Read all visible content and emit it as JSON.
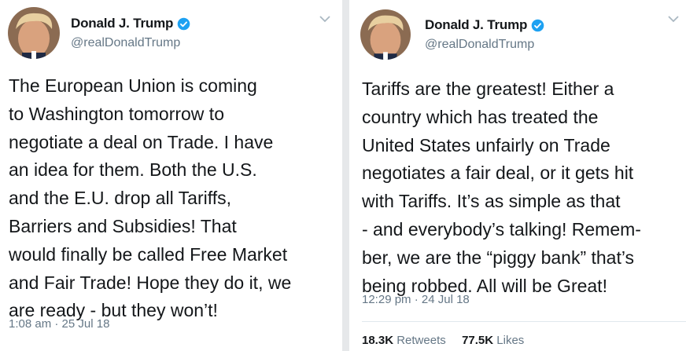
{
  "tweets": [
    {
      "author": {
        "name": "Donald J. Trump",
        "handle": "@realDonaldTrump",
        "verified": true
      },
      "text": "The European Union is coming\nto Washington tomorrow to\nnegotiate a deal on Trade. I have\nan idea for them. Both the U.S.\nand the E.U. drop all Tariffs,\nBarriers and Subsidies! That\nwould finally be called Free Market\nand Fair Trade! Hope they do it, we\nare ready - but they won’t!",
      "timestamp": "1:08 am · 25 Jul 18"
    },
    {
      "author": {
        "name": "Donald J. Trump",
        "handle": "@realDonaldTrump",
        "verified": true
      },
      "text": "Tariffs are the greatest! Either a\ncountry which has treated the\nUnited States unfairly on Trade\nnegotiates a fair deal, or it gets hit\nwith Tariffs. It’s as simple as that\n- and everybody’s talking! Remem-\nber, we are the “piggy bank” that’s\nbeing robbed. All will be Great!",
      "timestamp": "12:29 pm · 24 Jul 18",
      "stats": {
        "retweets_count": "18.3K",
        "retweets_label": "Retweets",
        "likes_count": "77.5K",
        "likes_label": "Likes"
      }
    }
  ],
  "icons": {
    "verified": "verified-badge-icon",
    "menu": "chevron-down-icon"
  },
  "colors": {
    "verified_blue": "#1da1f2",
    "text": "#14171a",
    "secondary": "#657786"
  }
}
